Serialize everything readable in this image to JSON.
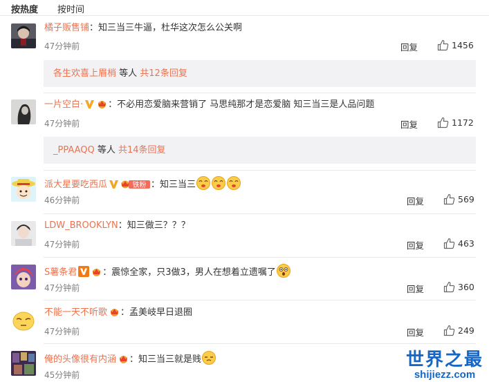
{
  "sort": {
    "hot_label": "按热度",
    "time_label": "按时间"
  },
  "separator": "：",
  "comments": [
    {
      "username": "橘子贩售铺",
      "text": "知三当三牛逼，杜华这次怎么公关啊",
      "time": "47分钟前",
      "reply_label": "回复",
      "likes": "1456",
      "sub_reply": {
        "names": "各生欢喜上眉梢",
        "middle": " 等人 ",
        "count_link": "共12条回复"
      }
    },
    {
      "username": "一片空白·",
      "text": "不必用恋爱脑来营销了 马思纯那才是恋爱脑 知三当三是人品问题",
      "time": "47分钟前",
      "reply_label": "回复",
      "likes": "1172",
      "sub_reply": {
        "names": "_PPAAQQ",
        "middle": " 等人 ",
        "count_link": "共14条回复"
      }
    },
    {
      "username": "派大星要吃西瓜",
      "text": "知三当三",
      "fan_badge": "铁粉",
      "time": "46分钟前",
      "reply_label": "回复",
      "likes": "569"
    },
    {
      "username": "LDW_BROOKLYN",
      "text": "知三做三？？？",
      "time": "47分钟前",
      "reply_label": "回复",
      "likes": "463"
    },
    {
      "username": "S薯条君",
      "text": "震惊全家，只3做3，男人在想着立遗嘱了",
      "time": "47分钟前",
      "reply_label": "回复",
      "likes": "360"
    },
    {
      "username": "不能一天不听歌",
      "text": "孟美岐早日退圈",
      "time": "47分钟前",
      "reply_label": "回复",
      "likes": "249"
    },
    {
      "username": "俺的头像很有内涵",
      "text": "知三当三就是贱",
      "time": "45分钟前"
    }
  ],
  "watermark": {
    "title": "世界之最",
    "url": "shijiezz.com"
  },
  "colors": {
    "username": "#eb7350",
    "time": "#808080",
    "sub_reply_bg": "#f2f2f5",
    "watermark": "#1666c5"
  },
  "icons": [
    "thumb-up-icon",
    "verified-v-icon",
    "member-crown-icon",
    "fan-badge-icon",
    "emoji-icon"
  ]
}
